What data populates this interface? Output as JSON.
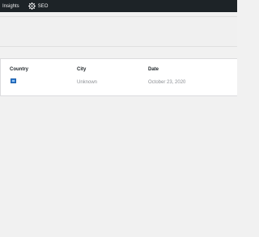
{
  "adminbar": {
    "items": [
      {
        "label": "Insights"
      },
      {
        "label": "SEO",
        "icon": "gear-icon"
      }
    ]
  },
  "table": {
    "headers": [
      "Country",
      "City",
      "Date"
    ],
    "rows": [
      {
        "country_flag": "flag-icon",
        "city": "Unknown",
        "date": "October 23, 2020"
      }
    ]
  },
  "colors": {
    "adminbar_bg": "#1d2327",
    "page_bg": "#f1f1f1",
    "card_bg": "#ffffff",
    "muted_text": "#8c8f94"
  }
}
